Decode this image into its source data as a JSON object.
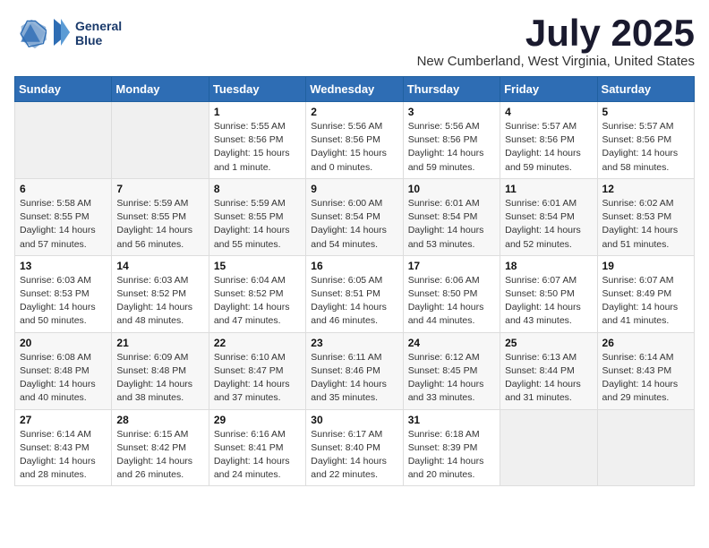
{
  "logo": {
    "line1": "General",
    "line2": "Blue"
  },
  "title": "July 2025",
  "location": "New Cumberland, West Virginia, United States",
  "weekdays": [
    "Sunday",
    "Monday",
    "Tuesday",
    "Wednesday",
    "Thursday",
    "Friday",
    "Saturday"
  ],
  "weeks": [
    [
      {
        "day": "",
        "sunrise": "",
        "sunset": "",
        "daylight": ""
      },
      {
        "day": "",
        "sunrise": "",
        "sunset": "",
        "daylight": ""
      },
      {
        "day": "1",
        "sunrise": "Sunrise: 5:55 AM",
        "sunset": "Sunset: 8:56 PM",
        "daylight": "Daylight: 15 hours and 1 minute."
      },
      {
        "day": "2",
        "sunrise": "Sunrise: 5:56 AM",
        "sunset": "Sunset: 8:56 PM",
        "daylight": "Daylight: 15 hours and 0 minutes."
      },
      {
        "day": "3",
        "sunrise": "Sunrise: 5:56 AM",
        "sunset": "Sunset: 8:56 PM",
        "daylight": "Daylight: 14 hours and 59 minutes."
      },
      {
        "day": "4",
        "sunrise": "Sunrise: 5:57 AM",
        "sunset": "Sunset: 8:56 PM",
        "daylight": "Daylight: 14 hours and 59 minutes."
      },
      {
        "day": "5",
        "sunrise": "Sunrise: 5:57 AM",
        "sunset": "Sunset: 8:56 PM",
        "daylight": "Daylight: 14 hours and 58 minutes."
      }
    ],
    [
      {
        "day": "6",
        "sunrise": "Sunrise: 5:58 AM",
        "sunset": "Sunset: 8:55 PM",
        "daylight": "Daylight: 14 hours and 57 minutes."
      },
      {
        "day": "7",
        "sunrise": "Sunrise: 5:59 AM",
        "sunset": "Sunset: 8:55 PM",
        "daylight": "Daylight: 14 hours and 56 minutes."
      },
      {
        "day": "8",
        "sunrise": "Sunrise: 5:59 AM",
        "sunset": "Sunset: 8:55 PM",
        "daylight": "Daylight: 14 hours and 55 minutes."
      },
      {
        "day": "9",
        "sunrise": "Sunrise: 6:00 AM",
        "sunset": "Sunset: 8:54 PM",
        "daylight": "Daylight: 14 hours and 54 minutes."
      },
      {
        "day": "10",
        "sunrise": "Sunrise: 6:01 AM",
        "sunset": "Sunset: 8:54 PM",
        "daylight": "Daylight: 14 hours and 53 minutes."
      },
      {
        "day": "11",
        "sunrise": "Sunrise: 6:01 AM",
        "sunset": "Sunset: 8:54 PM",
        "daylight": "Daylight: 14 hours and 52 minutes."
      },
      {
        "day": "12",
        "sunrise": "Sunrise: 6:02 AM",
        "sunset": "Sunset: 8:53 PM",
        "daylight": "Daylight: 14 hours and 51 minutes."
      }
    ],
    [
      {
        "day": "13",
        "sunrise": "Sunrise: 6:03 AM",
        "sunset": "Sunset: 8:53 PM",
        "daylight": "Daylight: 14 hours and 50 minutes."
      },
      {
        "day": "14",
        "sunrise": "Sunrise: 6:03 AM",
        "sunset": "Sunset: 8:52 PM",
        "daylight": "Daylight: 14 hours and 48 minutes."
      },
      {
        "day": "15",
        "sunrise": "Sunrise: 6:04 AM",
        "sunset": "Sunset: 8:52 PM",
        "daylight": "Daylight: 14 hours and 47 minutes."
      },
      {
        "day": "16",
        "sunrise": "Sunrise: 6:05 AM",
        "sunset": "Sunset: 8:51 PM",
        "daylight": "Daylight: 14 hours and 46 minutes."
      },
      {
        "day": "17",
        "sunrise": "Sunrise: 6:06 AM",
        "sunset": "Sunset: 8:50 PM",
        "daylight": "Daylight: 14 hours and 44 minutes."
      },
      {
        "day": "18",
        "sunrise": "Sunrise: 6:07 AM",
        "sunset": "Sunset: 8:50 PM",
        "daylight": "Daylight: 14 hours and 43 minutes."
      },
      {
        "day": "19",
        "sunrise": "Sunrise: 6:07 AM",
        "sunset": "Sunset: 8:49 PM",
        "daylight": "Daylight: 14 hours and 41 minutes."
      }
    ],
    [
      {
        "day": "20",
        "sunrise": "Sunrise: 6:08 AM",
        "sunset": "Sunset: 8:48 PM",
        "daylight": "Daylight: 14 hours and 40 minutes."
      },
      {
        "day": "21",
        "sunrise": "Sunrise: 6:09 AM",
        "sunset": "Sunset: 8:48 PM",
        "daylight": "Daylight: 14 hours and 38 minutes."
      },
      {
        "day": "22",
        "sunrise": "Sunrise: 6:10 AM",
        "sunset": "Sunset: 8:47 PM",
        "daylight": "Daylight: 14 hours and 37 minutes."
      },
      {
        "day": "23",
        "sunrise": "Sunrise: 6:11 AM",
        "sunset": "Sunset: 8:46 PM",
        "daylight": "Daylight: 14 hours and 35 minutes."
      },
      {
        "day": "24",
        "sunrise": "Sunrise: 6:12 AM",
        "sunset": "Sunset: 8:45 PM",
        "daylight": "Daylight: 14 hours and 33 minutes."
      },
      {
        "day": "25",
        "sunrise": "Sunrise: 6:13 AM",
        "sunset": "Sunset: 8:44 PM",
        "daylight": "Daylight: 14 hours and 31 minutes."
      },
      {
        "day": "26",
        "sunrise": "Sunrise: 6:14 AM",
        "sunset": "Sunset: 8:43 PM",
        "daylight": "Daylight: 14 hours and 29 minutes."
      }
    ],
    [
      {
        "day": "27",
        "sunrise": "Sunrise: 6:14 AM",
        "sunset": "Sunset: 8:43 PM",
        "daylight": "Daylight: 14 hours and 28 minutes."
      },
      {
        "day": "28",
        "sunrise": "Sunrise: 6:15 AM",
        "sunset": "Sunset: 8:42 PM",
        "daylight": "Daylight: 14 hours and 26 minutes."
      },
      {
        "day": "29",
        "sunrise": "Sunrise: 6:16 AM",
        "sunset": "Sunset: 8:41 PM",
        "daylight": "Daylight: 14 hours and 24 minutes."
      },
      {
        "day": "30",
        "sunrise": "Sunrise: 6:17 AM",
        "sunset": "Sunset: 8:40 PM",
        "daylight": "Daylight: 14 hours and 22 minutes."
      },
      {
        "day": "31",
        "sunrise": "Sunrise: 6:18 AM",
        "sunset": "Sunset: 8:39 PM",
        "daylight": "Daylight: 14 hours and 20 minutes."
      },
      {
        "day": "",
        "sunrise": "",
        "sunset": "",
        "daylight": ""
      },
      {
        "day": "",
        "sunrise": "",
        "sunset": "",
        "daylight": ""
      }
    ]
  ]
}
